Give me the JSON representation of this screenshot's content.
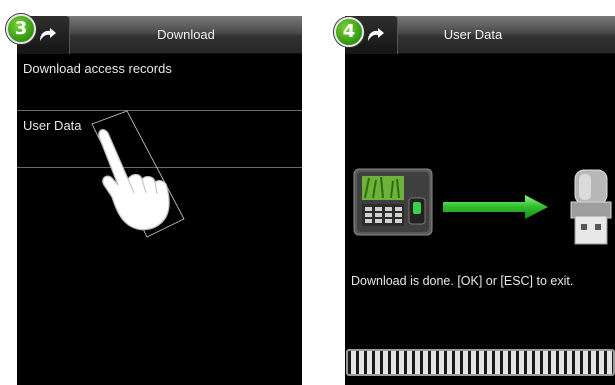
{
  "steps": [
    {
      "number": "3"
    },
    {
      "number": "4"
    }
  ],
  "left_screen": {
    "title": "Download",
    "menu_items": [
      {
        "label": "Download access records"
      },
      {
        "label": "User Data"
      }
    ]
  },
  "right_screen": {
    "title": "User Data",
    "status_text": "Download is done. [OK] or [ESC] to exit.",
    "progress_fraction": 1.0
  },
  "icons": [
    "back-arrow-icon",
    "hand-pointer-icon",
    "attendance-device-icon",
    "green-arrow-icon",
    "usb-drive-icon"
  ],
  "colors": {
    "badge": "#3da11a",
    "arrow": "#35c02a",
    "screen": "#000000"
  }
}
